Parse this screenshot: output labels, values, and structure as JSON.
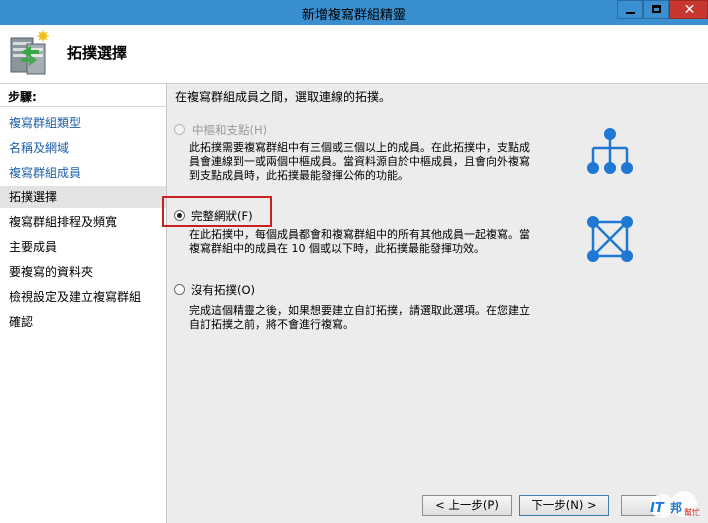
{
  "window": {
    "title": "新增複寫群組精靈",
    "close_glyph": "✕"
  },
  "header": {
    "title": "拓撲選擇",
    "icon": "wizard-server-icon"
  },
  "sidebar": {
    "heading": "步驟:",
    "items": [
      {
        "label": "複寫群組類型"
      },
      {
        "label": "名稱及網域"
      },
      {
        "label": "複寫群組成員"
      },
      {
        "label": "拓撲選擇"
      },
      {
        "label": "複寫群組排程及頻寬"
      },
      {
        "label": "主要成員"
      },
      {
        "label": "要複寫的資料夾"
      },
      {
        "label": "檢視設定及建立複寫群組"
      },
      {
        "label": "確認"
      }
    ]
  },
  "main": {
    "intro": "在複寫群組成員之間，選取連線的拓撲。",
    "options": [
      {
        "label": "中樞和支點(H)",
        "enabled": false,
        "selected": false,
        "desc_lines": [
          "此拓撲需要複寫群組中有三個或三個以上的成員。在此拓撲中，支點成",
          "員會連線到一或兩個中樞成員。當資料源自於中樞成員，且會向外複寫",
          "到支點成員時，此拓撲最能發揮公佈的功能。"
        ],
        "icon": "hub-spoke-topology-icon"
      },
      {
        "label": "完整網狀(F)",
        "enabled": true,
        "selected": true,
        "desc_lines": [
          "在此拓撲中，每個成員都會和複寫群組中的所有其他成員一起複寫。當",
          "複寫群組中的成員在 10 個或以下時，此拓撲最能發揮功效。"
        ],
        "icon": "full-mesh-topology-icon"
      },
      {
        "label": "沒有拓撲(O)",
        "enabled": true,
        "selected": false,
        "desc_lines": [
          "完成這個精靈之後，如果想要建立自訂拓撲，請選取此選項。在您建立",
          "自訂拓撲之前，將不會進行複寫。"
        ]
      }
    ]
  },
  "footer": {
    "prev_label": "< 上一步(P)",
    "next_label": "下一步(N) >"
  },
  "colors": {
    "accent_blue": "#1e78d4",
    "highlight_red": "#c8201e",
    "link_blue": "#1b5fa8"
  }
}
